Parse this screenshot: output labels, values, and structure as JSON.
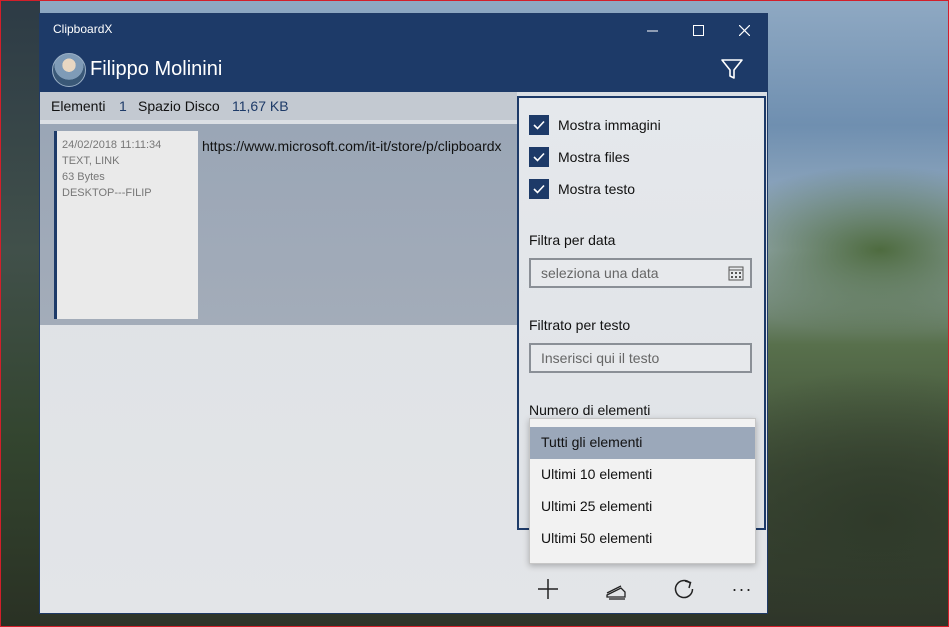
{
  "window": {
    "app_title": "ClipboardX",
    "minimize_glyph": "—",
    "maximize_glyph": "☐",
    "close_glyph": "✕"
  },
  "header": {
    "user_name": "Filippo Molinini",
    "avatar_icon": "user-avatar",
    "filter_icon": "filter-icon"
  },
  "stats": {
    "elements_label": "Elementi",
    "elements_count": "1",
    "disk_label": "Spazio Disco",
    "disk_value": "11,67 KB"
  },
  "items": [
    {
      "timestamp": "24/02/2018 11:11:34",
      "types": "TEXT, LINK",
      "size": "63 Bytes",
      "device": "DESKTOP---FILIP",
      "content": "https://www.microsoft.com/it-it/store/p/clipboardx"
    }
  ],
  "filters": {
    "show_images": {
      "label": "Mostra immagini",
      "checked": true
    },
    "show_files": {
      "label": "Mostra files",
      "checked": true
    },
    "show_text": {
      "label": "Mostra testo",
      "checked": true
    },
    "date_filter": {
      "label": "Filtra per data",
      "placeholder": "seleziona una data"
    },
    "text_filter": {
      "label": "Filtrato per testo",
      "placeholder": "Inserisci qui il testo"
    },
    "count_filter": {
      "label": "Numero di elementi",
      "options": [
        "Tutti gli elementi",
        "Ultimi 10 elementi",
        "Ultimi 25 elementi",
        "Ultimi 50 elementi"
      ],
      "selected": "Tutti gli elementi"
    }
  },
  "toolbar": {
    "add_icon": "add-icon",
    "clear_icon": "eraser-icon",
    "refresh_icon": "refresh-icon",
    "more_label": "···"
  },
  "colors": {
    "accent": "#1d3a68",
    "selected_option": "#9ba8ba",
    "frame": "#d21f2a"
  }
}
